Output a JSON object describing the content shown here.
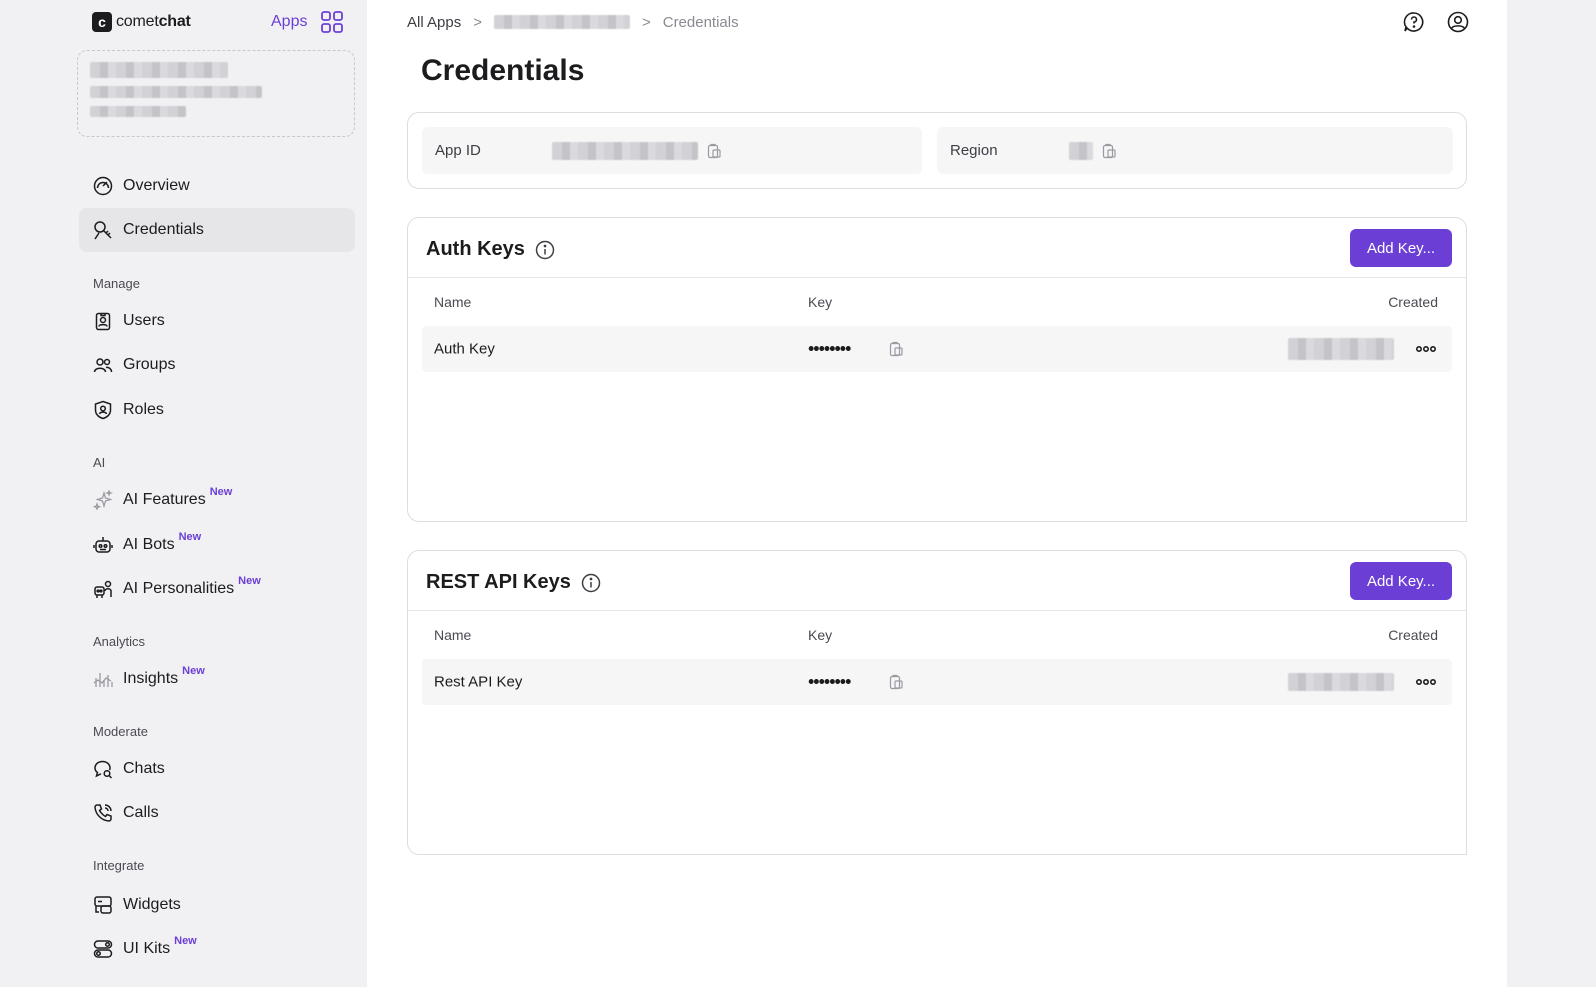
{
  "logo": {
    "brand_light": "comet",
    "brand_bold": "chat"
  },
  "apps_link": "Apps",
  "nav": {
    "overview": "Overview",
    "credentials": "Credentials",
    "manage_label": "Manage",
    "users": "Users",
    "groups": "Groups",
    "roles": "Roles",
    "ai_label": "AI",
    "ai_features": "AI Features",
    "ai_bots": "AI Bots",
    "ai_personalities": "AI Personalities",
    "analytics_label": "Analytics",
    "insights": "Insights",
    "moderate_label": "Moderate",
    "chats": "Chats",
    "calls": "Calls",
    "integrate_label": "Integrate",
    "widgets": "Widgets",
    "ui_kits": "UI Kits",
    "new_badge": "New"
  },
  "breadcrumb": {
    "root": "All Apps",
    "separator": ">",
    "current": "Credentials"
  },
  "page_title": "Credentials",
  "credentials": {
    "app_id_label": "App ID",
    "region_label": "Region"
  },
  "auth_keys": {
    "title": "Auth Keys",
    "add_button": "Add Key...",
    "columns": {
      "name": "Name",
      "key": "Key",
      "created": "Created"
    },
    "rows": [
      {
        "name": "Auth Key",
        "key_masked": "••••••••"
      }
    ]
  },
  "rest_keys": {
    "title": "REST API Keys",
    "add_button": "Add Key...",
    "columns": {
      "name": "Name",
      "key": "Key",
      "created": "Created"
    },
    "rows": [
      {
        "name": "Rest API Key",
        "key_masked": "••••••••"
      }
    ]
  },
  "colors": {
    "accent": "#6b3fd6",
    "sidebar_bg": "#f1f1f3",
    "active_item_bg": "#e6e6e9"
  }
}
